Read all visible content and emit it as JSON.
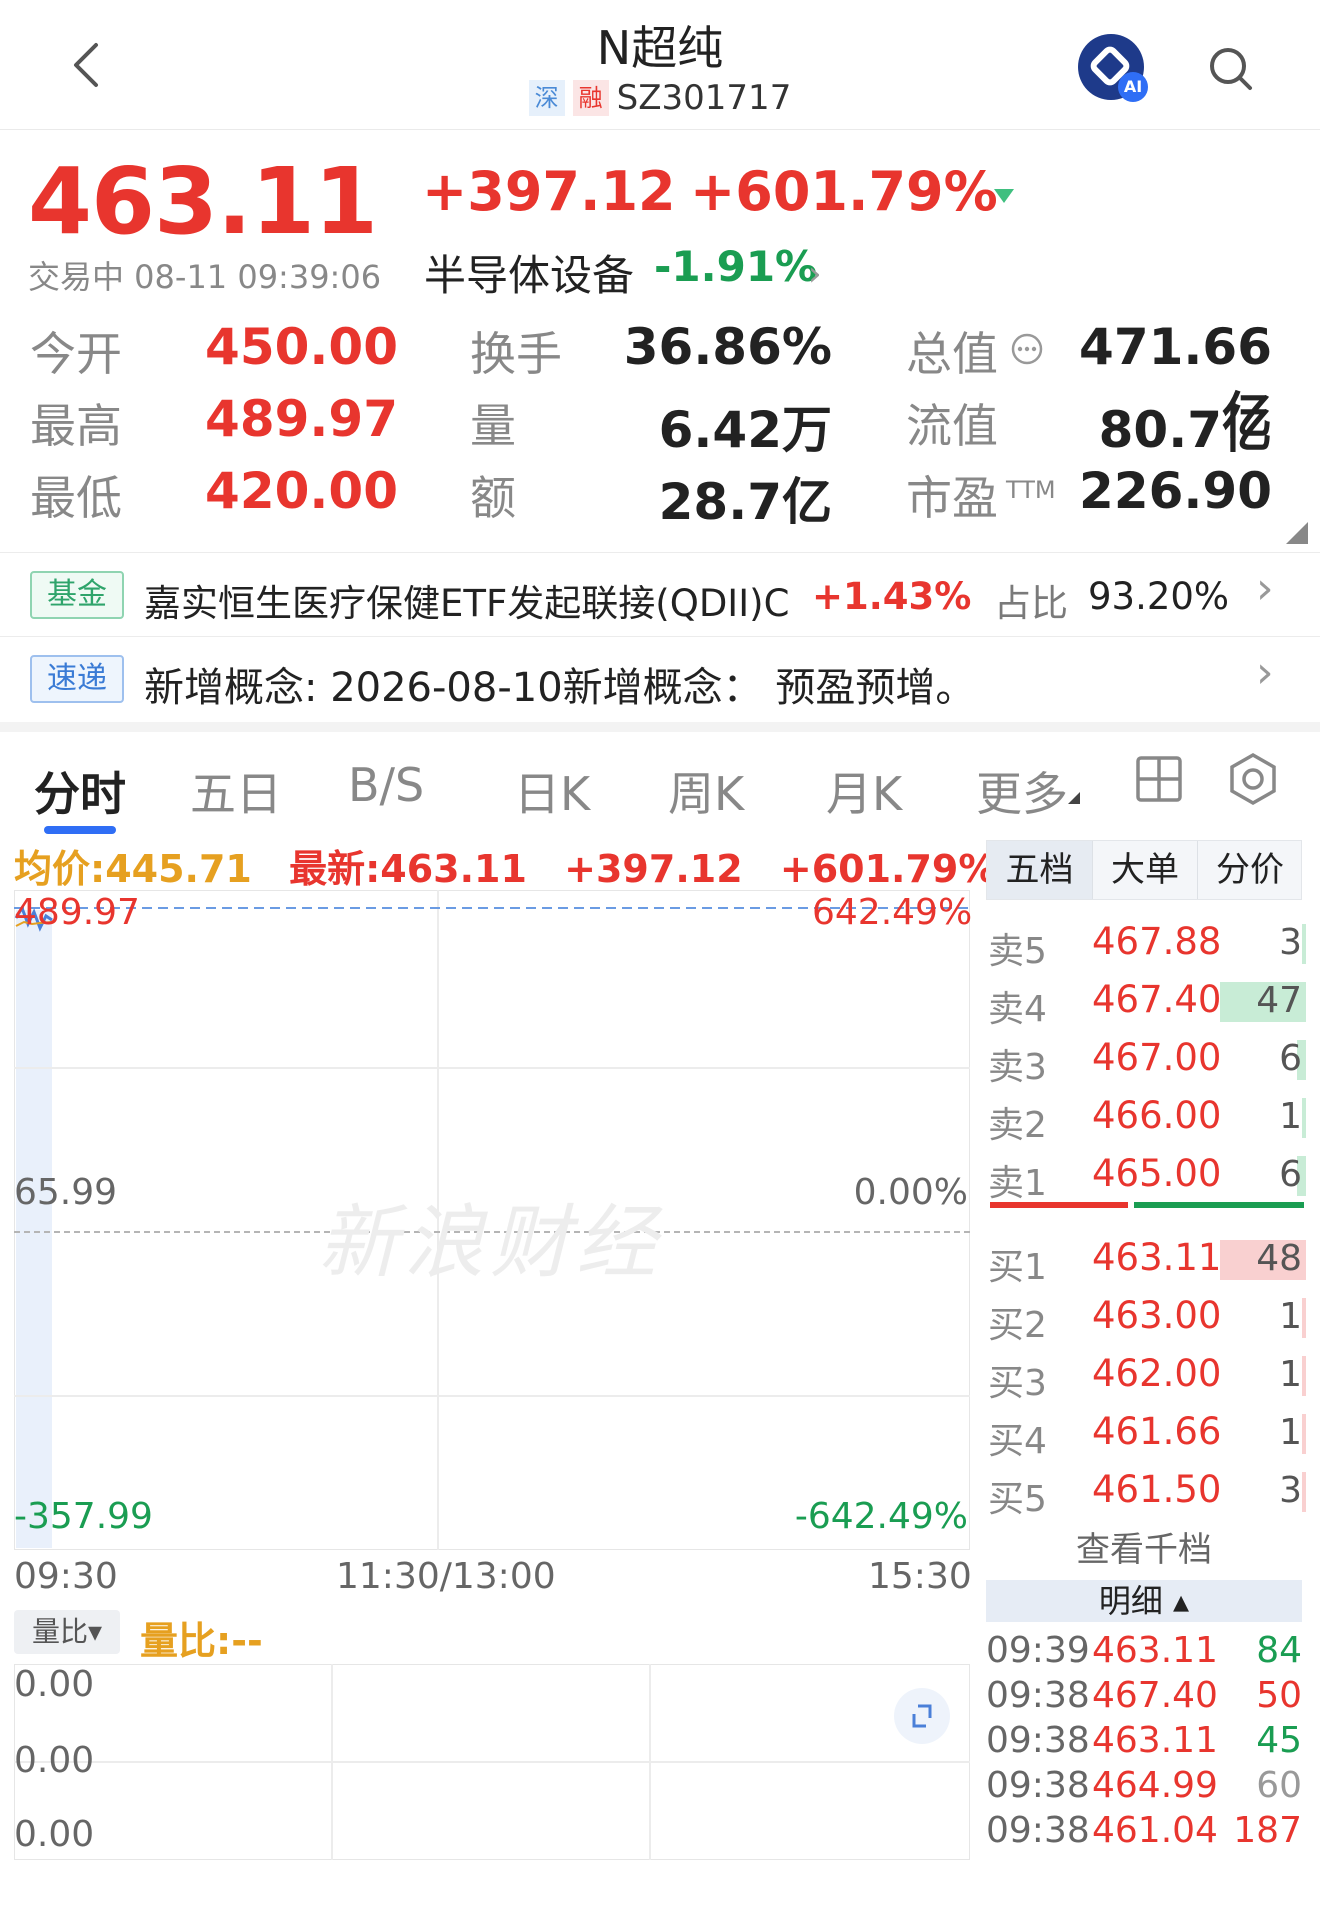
{
  "header": {
    "title": "N超纯",
    "market_tag": "深",
    "margin_tag": "融",
    "code": "SZ301717",
    "ai_badge": "AI"
  },
  "quote": {
    "price": "463.11",
    "change": "+397.12",
    "change_pct": "+601.79%",
    "status": "交易中 08-11 09:39:06",
    "industry": "半导体设备",
    "industry_pct": "-1.91%",
    "stats": [
      {
        "label": "今开",
        "value": "450.00",
        "color": "#e8352e"
      },
      {
        "label": "最高",
        "value": "489.97",
        "color": "#e8352e"
      },
      {
        "label": "最低",
        "value": "420.00",
        "color": "#e8352e"
      },
      {
        "label": "换手",
        "value": "36.86%",
        "color": "#222222"
      },
      {
        "label": "量",
        "value": "6.42万",
        "color": "#222222"
      },
      {
        "label": "额",
        "value": "28.7亿",
        "color": "#222222"
      },
      {
        "label": "总值",
        "value": "471.66亿",
        "color": "#222222"
      },
      {
        "label": "流值",
        "value": "80.7亿",
        "color": "#222222"
      },
      {
        "label": "市盈",
        "label_sup": "TTM",
        "value": "226.90",
        "color": "#222222"
      }
    ]
  },
  "fund_banner": {
    "badge": "基金",
    "name": "嘉实恒生医疗保健ETF发起联接(QDII)C",
    "pct": "+1.43%",
    "share_label": "占比",
    "share_value": "93.20%"
  },
  "news_banner": {
    "badge": "速递",
    "text": "新增概念: 2026-08-10新增概念：  预盈预增。"
  },
  "tabs": [
    "分时",
    "五日",
    "B/S",
    "日K",
    "周K",
    "月K",
    "更多"
  ],
  "chart_info": {
    "avg": "均价:445.71",
    "latest": "最新:463.11",
    "change": "+397.12",
    "change_pct": "+601.79%"
  },
  "chart_axes": {
    "y_top_left": "489.97",
    "y_top_right": "642.49%",
    "y_mid_left": "65.99",
    "y_mid_right": "0.00%",
    "y_bot_left": "-357.99",
    "y_bot_right": "-642.49%",
    "time_start": "09:30",
    "time_mid": "11:30/13:00",
    "time_end": "15:30"
  },
  "watermark": "新浪财经",
  "volume_panel": {
    "selector": "量比▾",
    "label": "量比:--",
    "axis": [
      "0.00",
      "0.00",
      "0.00"
    ]
  },
  "orderbook": {
    "tabs": [
      "五档",
      "大单",
      "分价"
    ],
    "asks": [
      {
        "label": "卖5",
        "price": "467.88",
        "vol": "3",
        "bar": 0.0
      },
      {
        "label": "卖4",
        "price": "467.40",
        "vol": "47",
        "bar": 1.0
      },
      {
        "label": "卖3",
        "price": "467.00",
        "vol": "6",
        "bar": 0.1
      },
      {
        "label": "卖2",
        "price": "466.00",
        "vol": "1",
        "bar": 0.05
      },
      {
        "label": "卖1",
        "price": "465.00",
        "vol": "6",
        "bar": 0.1
      }
    ],
    "bids": [
      {
        "label": "买1",
        "price": "463.11",
        "vol": "48",
        "bar": 1.0
      },
      {
        "label": "买2",
        "price": "463.00",
        "vol": "1",
        "bar": 0.05
      },
      {
        "label": "买3",
        "price": "462.00",
        "vol": "1",
        "bar": 0.05
      },
      {
        "label": "买4",
        "price": "461.66",
        "vol": "1",
        "bar": 0.05
      },
      {
        "label": "买5",
        "price": "461.50",
        "vol": "3",
        "bar": 0.05
      }
    ],
    "view_more": "查看千档",
    "detail_header": "明细 ▴",
    "ticks": [
      {
        "time": "09:39",
        "price": "463.11",
        "vol": "84",
        "color": "#1a9d52"
      },
      {
        "time": "09:38",
        "price": "467.40",
        "vol": "50",
        "color": "#e8352e"
      },
      {
        "time": "09:38",
        "price": "463.11",
        "vol": "45",
        "color": "#1a9d52"
      },
      {
        "time": "09:38",
        "price": "464.99",
        "vol": "60",
        "color": "#999999"
      },
      {
        "time": "09:38",
        "price": "461.04",
        "vol": "187",
        "color": "#e8352e"
      }
    ]
  }
}
